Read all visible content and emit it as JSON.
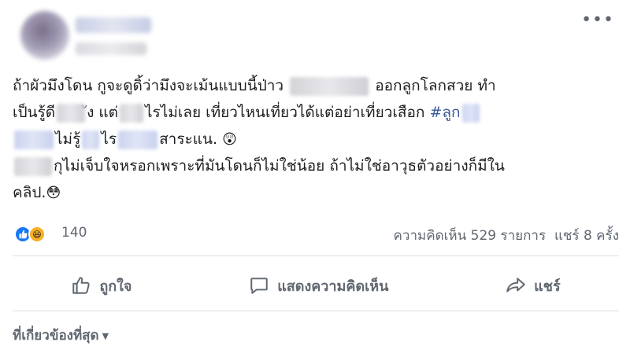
{
  "post": {
    "menu_icon": "more-horizontal-icon",
    "lines": {
      "l1a": "ถ้าผัวมึงโดน กูจะดูดิ้ว่ามึงจะเม้นแบบนี้ป่าว",
      "l1b": "ออกลูกโลกสวย ทำ",
      "l2a": "เป็นรู้ดี",
      "l2b": "ัง แต่",
      "l2c": "ไรไม่เลย เที่ยวไหนเที่ยวได้แต่อย่าเที่ยวเสือก",
      "l2d": "#ลูก",
      "l3a": "ไม่รู้",
      "l3b": "ไร",
      "l3c": "สาระแน.",
      "l4a": "กุไม่เจ็บใจหรอกเพราะที่มันโดนก็ไม่ใช่น้อย ถ้าไม่ใช่อาวุธตัวอย่างก็มีใน",
      "l5a": "คลิป."
    }
  },
  "reactions": {
    "count": "140",
    "icons": [
      "like-icon",
      "haha-icon"
    ]
  },
  "stats": {
    "comments": "ความคิดเห็น 529 รายการ",
    "shares": "แชร์ 8 ครั้ง"
  },
  "actions": {
    "like": "ถูกใจ",
    "comment": "แสดงความคิดเห็น",
    "share": "แชร์"
  },
  "comments": {
    "sort_label": "ที่เกี่ยวข้องที่สุด"
  },
  "colors": {
    "text": "#1c1e21",
    "secondary": "#606770",
    "link": "#385898",
    "like_blue": "#1877f2",
    "haha_yellow": "#f7b125"
  }
}
